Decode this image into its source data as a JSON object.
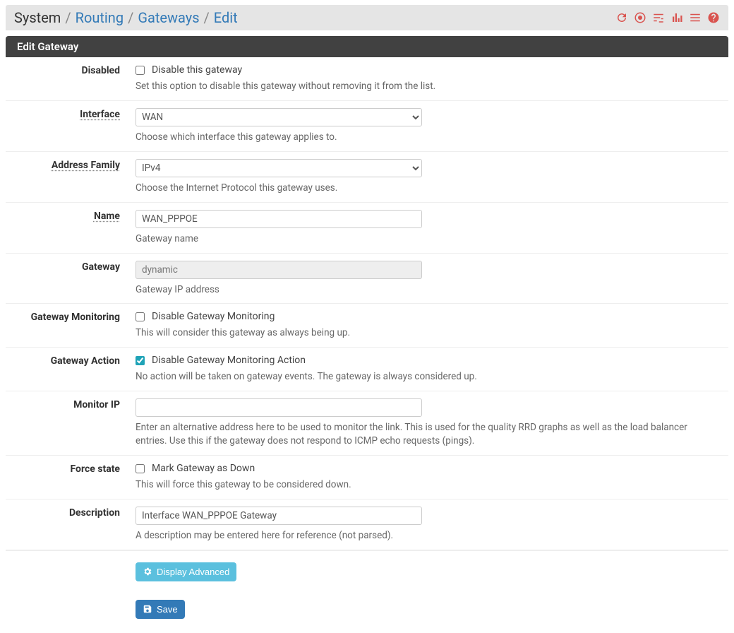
{
  "breadcrumb": {
    "system": "System",
    "routing": "Routing",
    "gateways": "Gateways",
    "edit": "Edit"
  },
  "panel": {
    "title": "Edit Gateway"
  },
  "fields": {
    "disabled": {
      "label": "Disabled",
      "check_label": "Disable this gateway",
      "help": "Set this option to disable this gateway without removing it from the list.",
      "checked": false
    },
    "interface": {
      "label": "Interface",
      "value": "WAN",
      "help": "Choose which interface this gateway applies to."
    },
    "address_family": {
      "label": "Address Family",
      "value": "IPv4",
      "help": "Choose the Internet Protocol this gateway uses."
    },
    "name": {
      "label": "Name",
      "value": "WAN_PPPOE",
      "help": "Gateway name"
    },
    "gateway": {
      "label": "Gateway",
      "value": "dynamic",
      "help": "Gateway IP address"
    },
    "monitoring": {
      "label": "Gateway Monitoring",
      "check_label": "Disable Gateway Monitoring",
      "help": "This will consider this gateway as always being up.",
      "checked": false
    },
    "action": {
      "label": "Gateway Action",
      "check_label": "Disable Gateway Monitoring Action",
      "help": "No action will be taken on gateway events. The gateway is always considered up.",
      "checked": true
    },
    "monitor_ip": {
      "label": "Monitor IP",
      "value": "",
      "help": "Enter an alternative address here to be used to monitor the link. This is used for the quality RRD graphs as well as the load balancer entries. Use this if the gateway does not respond to ICMP echo requests (pings)."
    },
    "force_state": {
      "label": "Force state",
      "check_label": "Mark Gateway as Down",
      "help": "This will force this gateway to be considered down.",
      "checked": false
    },
    "description": {
      "label": "Description",
      "value": "Interface WAN_PPPOE Gateway",
      "help": "A description may be entered here for reference (not parsed)."
    }
  },
  "buttons": {
    "display_advanced": "Display Advanced",
    "save": "Save"
  },
  "icons": {
    "refresh": "refresh-icon",
    "stop": "stop-icon",
    "sliders": "sliders-icon",
    "stats": "stats-icon",
    "list": "list-icon",
    "help": "help-icon"
  }
}
